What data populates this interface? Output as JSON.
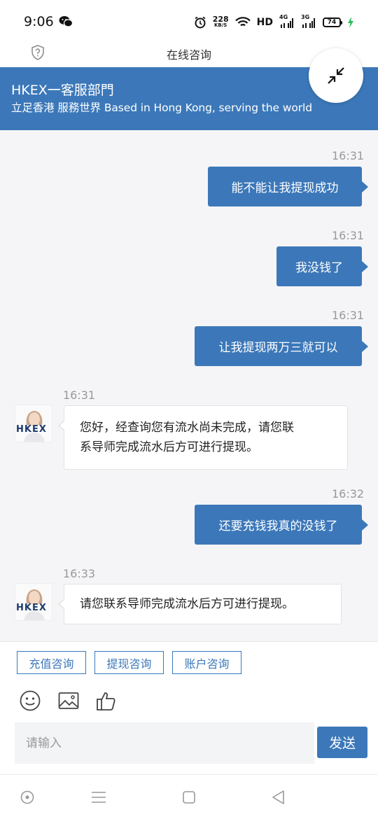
{
  "status_bar": {
    "time": "9:06",
    "speed_value": "228",
    "speed_unit": "KB/S",
    "hd_label": "HD",
    "network_1": "4G",
    "network_2": "3G",
    "battery_level": "74"
  },
  "titlebar": {
    "title": "在线咨询"
  },
  "header": {
    "title": "HKEX一客服部門",
    "subtitle": "立足香港 服務世界 Based in Hong Kong, serving the world"
  },
  "colors": {
    "brand": "#3c78b9",
    "chat_bg": "#f5f5f7"
  },
  "messages": [
    {
      "from": "user",
      "time": "16:31",
      "text": "能不能让我提现成功"
    },
    {
      "from": "user",
      "time": "16:31",
      "text": "我没钱了"
    },
    {
      "from": "user",
      "time": "16:31",
      "text": "让我提现两万三就可以"
    },
    {
      "from": "agent",
      "time": "16:31",
      "line1": "您好，经查询您有流水尚未完成，请您联",
      "line2": "系导师完成流水后方可进行提现。"
    },
    {
      "from": "user",
      "time": "16:32",
      "text": "还要充钱我真的没钱了"
    },
    {
      "from": "agent",
      "time": "16:33",
      "line1": "请您联系导师完成流水后方可进行提现。"
    }
  ],
  "avatar_logo": "HKEX",
  "quick_replies": [
    "充值咨询",
    "提现咨询",
    "账户咨询"
  ],
  "toolbar_icons": [
    "emoji-icon",
    "image-icon",
    "thumbs-up-icon"
  ],
  "input": {
    "placeholder": "请输入"
  },
  "send_label": "发送"
}
